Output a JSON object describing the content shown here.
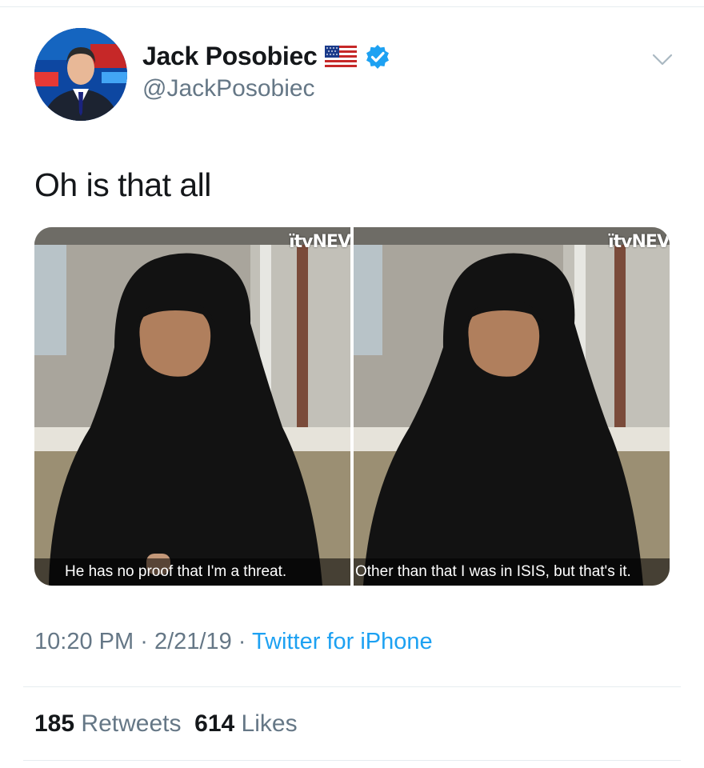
{
  "author": {
    "display_name": "Jack Posobiec",
    "handle": "@JackPosobiec",
    "flag_icon": "us-flag-icon",
    "verified_icon": "verified-badge-icon",
    "verified_color": "#1da1f2"
  },
  "tweet": {
    "text": "Oh is that all",
    "media": [
      {
        "watermark": "ïtvNEV",
        "caption": "He has no proof that I'm a threat."
      },
      {
        "watermark": "ïtvNEV",
        "caption": "Other than that I was in ISIS, but that's it."
      }
    ],
    "meta": {
      "time": "10:20 PM",
      "separator": "·",
      "date": "2/21/19",
      "source": "Twitter for iPhone"
    },
    "stats": {
      "retweets_count": "185",
      "retweets_label": "Retweets",
      "likes_count": "614",
      "likes_label": "Likes"
    }
  },
  "colors": {
    "text_primary": "#14171a",
    "text_secondary": "#657786",
    "link": "#1da1f2",
    "divider": "#e6ecf0"
  }
}
